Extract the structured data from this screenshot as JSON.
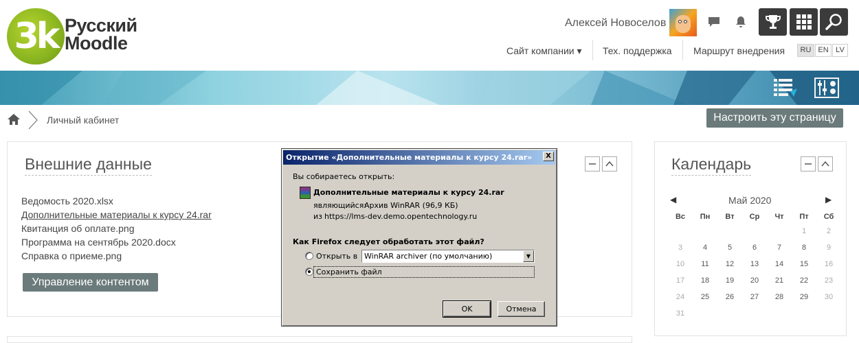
{
  "header": {
    "logo_line1": "Русский",
    "logo_line2": "Moodle",
    "logo_mark": "3k",
    "user_name": "Алексей Новоселов",
    "icons": [
      "chat-icon",
      "bell-icon",
      "trophy-icon",
      "grid-icon",
      "search-icon"
    ],
    "nav": [
      {
        "label": "Сайт компании ▾"
      },
      {
        "label": "Тех. поддержка"
      },
      {
        "label": "Маршрут внедрения"
      }
    ],
    "languages": [
      "RU",
      "EN",
      "LV"
    ],
    "active_language": "RU"
  },
  "breadcrumb": {
    "current": "Личный кабинет"
  },
  "configure_button": "Настроить эту страницу",
  "external_block": {
    "title": "Внешние данные",
    "files": [
      "Ведомость 2020.xlsx",
      "Дополнительные материалы к курсу 24.rar",
      "Квитанция об оплате.png",
      "Программа на сентябрь 2020.docx",
      "Справка о приеме.png"
    ],
    "manage_button": "Управление контентом"
  },
  "calendar": {
    "title": "Календарь",
    "prev": "◀",
    "next": "▶",
    "month": "Май 2020",
    "weekdays": [
      "Вс",
      "Пн",
      "Вт",
      "Ср",
      "Чт",
      "Пт",
      "Сб"
    ],
    "weeks": [
      [
        "",
        "",
        "",
        "",
        "",
        "1",
        "2"
      ],
      [
        "3",
        "4",
        "5",
        "6",
        "7",
        "8",
        "9"
      ],
      [
        "10",
        "11",
        "12",
        "13",
        "14",
        "15",
        "16"
      ],
      [
        "17",
        "18",
        "19",
        "20",
        "21",
        "22",
        "23"
      ],
      [
        "24",
        "25",
        "26",
        "27",
        "28",
        "29",
        "30"
      ],
      [
        "31",
        "",
        "",
        "",
        "",
        "",
        ""
      ]
    ]
  },
  "dialog": {
    "title": "Открытие «Дополнительные материалы к курсу 24.rar»",
    "close": "X",
    "intro": "Вы собираетесь открыть:",
    "filename": "Дополнительные материалы к курсу 24.rar",
    "type_label": "являющийся:",
    "type_value": "Архив WinRAR (96,9 КБ)",
    "from_label": "из",
    "from_value": "https://lms-dev.demo.opentechnology.ru",
    "question": "Как Firefox следует обработать этот файл?",
    "open_with_label": "Открыть в",
    "open_with_app": "WinRAR archiver (по умолчанию)",
    "save_label": "Сохранить файл",
    "selected_option": "save",
    "ok": "OK",
    "cancel": "Отмена"
  }
}
